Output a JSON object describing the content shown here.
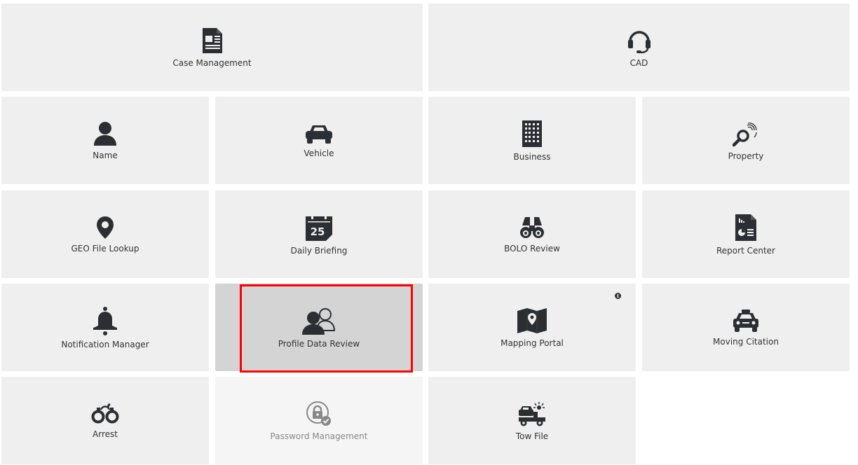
{
  "tiles": {
    "case_management": {
      "label": "Case Management",
      "icon": "case-file-icon"
    },
    "cad": {
      "label": "CAD",
      "icon": "headset-icon"
    },
    "name": {
      "label": "Name",
      "icon": "person-icon"
    },
    "vehicle": {
      "label": "Vehicle",
      "icon": "car-icon"
    },
    "business": {
      "label": "Business",
      "icon": "building-icon"
    },
    "property": {
      "label": "Property",
      "icon": "fingerprint-magnifier-icon"
    },
    "geo_file_lookup": {
      "label": "GEO File Lookup",
      "icon": "map-pin-icon"
    },
    "daily_briefing": {
      "label": "Daily Briefing",
      "icon": "calendar-icon",
      "day": "25"
    },
    "bolo_review": {
      "label": "BOLO Review",
      "icon": "binoculars-icon"
    },
    "report_center": {
      "label": "Report Center",
      "icon": "report-icon"
    },
    "notification_manager": {
      "label": "Notification Manager",
      "icon": "bell-icon"
    },
    "profile_data_review": {
      "label": "Profile Data Review",
      "icon": "users-icon"
    },
    "mapping_portal": {
      "label": "Mapping Portal",
      "icon": "map-icon",
      "badge": "i"
    },
    "moving_citation": {
      "label": "Moving Citation",
      "icon": "police-car-icon"
    },
    "arrest": {
      "label": "Arrest",
      "icon": "handcuffs-icon"
    },
    "password_management": {
      "label": "Password Management",
      "icon": "lock-check-icon"
    },
    "tow_file": {
      "label": "Tow File",
      "icon": "tow-truck-icon"
    }
  },
  "colors": {
    "tile_bg": "#efefef",
    "tile_hover_bg": "#d4d4d4",
    "icon": "#2b2f33",
    "disabled": "#888888",
    "highlight": "#ff0000"
  }
}
